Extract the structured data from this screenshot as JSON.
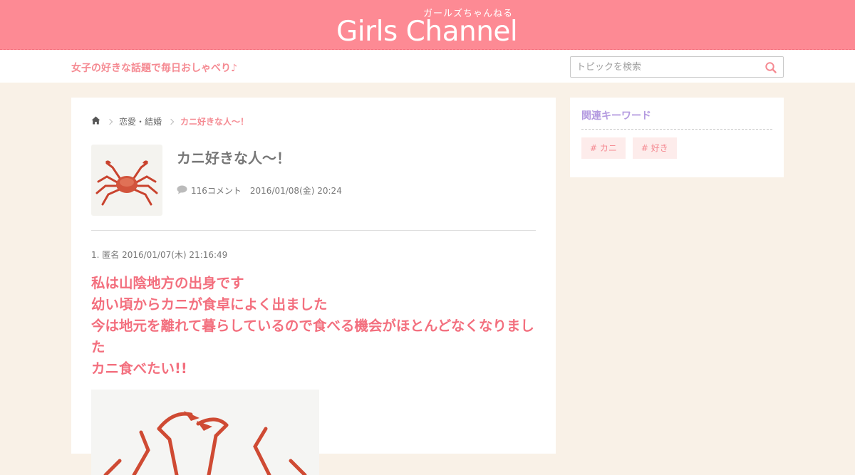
{
  "header": {
    "logo_kana": "ガールズちゃんねる",
    "logo_main": "Girls Channel",
    "tagline": "女子の好きな話題で毎日おしゃべり♪"
  },
  "search": {
    "placeholder": "トピックを検索",
    "icon": "search-icon"
  },
  "breadcrumb": {
    "home_icon": "home-icon",
    "category": "恋愛・結婚",
    "current": "カニ好きな人〜！"
  },
  "topic": {
    "title": "カニ好きな人〜！",
    "comment_icon": "comment-icon",
    "comment_count": "116コメント",
    "date": "2016/01/08(金) 20:24"
  },
  "post": {
    "header": "1. 匿名 2016/01/07(木) 21:16:49",
    "lines": [
      "私は山陰地方の出身です",
      "幼い頃からカニが食卓によく出ました",
      "今は地元を離れて暮らしているので食べる機会がほとんどなくなりました",
      "カニ食べたい!!"
    ]
  },
  "sidebar": {
    "title": "関連キーワード",
    "tags": [
      "# カニ",
      "# 好き"
    ]
  },
  "colors": {
    "header_pink": "#fd8a94",
    "accent_pink": "#f58a92",
    "post_text": "#f36f7e",
    "sidebar_title": "#b49be0",
    "page_bg": "#f9f1e7"
  }
}
